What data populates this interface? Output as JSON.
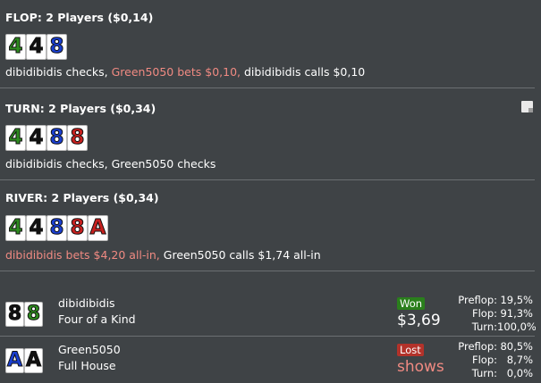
{
  "streets": [
    {
      "title": "FLOP: 2 Players ($0,14)",
      "cards": [
        {
          "rank": "4",
          "color": "#2e8b1f"
        },
        {
          "rank": "4",
          "color": "#111111"
        },
        {
          "rank": "8",
          "color": "#1a3fd1"
        }
      ],
      "actions": [
        {
          "text": "dibidibidis checks, ",
          "highlight": false
        },
        {
          "text": "Green5050 bets $0,10, ",
          "highlight": true
        },
        {
          "text": "dibidibidis calls $0,10",
          "highlight": false
        }
      ]
    },
    {
      "title": "TURN: 2 Players ($0,34)",
      "cards": [
        {
          "rank": "4",
          "color": "#2e8b1f"
        },
        {
          "rank": "4",
          "color": "#111111"
        },
        {
          "rank": "8",
          "color": "#1a3fd1"
        },
        {
          "rank": "8",
          "color": "#c8201e"
        }
      ],
      "actions": [
        {
          "text": "dibidibidis checks, Green5050 checks",
          "highlight": false
        }
      ]
    },
    {
      "title": "RIVER: 2 Players ($0,34)",
      "cards": [
        {
          "rank": "4",
          "color": "#2e8b1f"
        },
        {
          "rank": "4",
          "color": "#111111"
        },
        {
          "rank": "8",
          "color": "#1a3fd1"
        },
        {
          "rank": "8",
          "color": "#c8201e"
        },
        {
          "rank": "A",
          "color": "#c8201e"
        }
      ],
      "actions": [
        {
          "text": "dibidibidis bets $4,20 all-in, ",
          "highlight": true
        },
        {
          "text": "Green5050 calls $1,74 all-in",
          "highlight": false
        }
      ]
    }
  ],
  "players": [
    {
      "name": "dibidibidis",
      "hand": "Four of a Kind",
      "cards": [
        {
          "rank": "8",
          "color": "#111111"
        },
        {
          "rank": "8",
          "color": "#2e8b1f"
        }
      ],
      "result": "Won",
      "result_type": "won",
      "amount": "$3,69",
      "stats": [
        {
          "label": "Preflop:",
          "value": "19,5%"
        },
        {
          "label": "Flop:",
          "value": "91,3%"
        },
        {
          "label": "Turn:",
          "value": "100,0%"
        }
      ]
    },
    {
      "name": "Green5050",
      "hand": "Full House",
      "cards": [
        {
          "rank": "A",
          "color": "#1a3fd1"
        },
        {
          "rank": "A",
          "color": "#111111"
        }
      ],
      "result": "Lost",
      "result_type": "lost",
      "amount": "shows",
      "stats": [
        {
          "label": "Preflop:",
          "value": "80,5%"
        },
        {
          "label": "Flop:",
          "value": "8,7%"
        },
        {
          "label": "Turn:",
          "value": "0,0%"
        }
      ]
    }
  ],
  "icons": {
    "note": "note-icon"
  }
}
